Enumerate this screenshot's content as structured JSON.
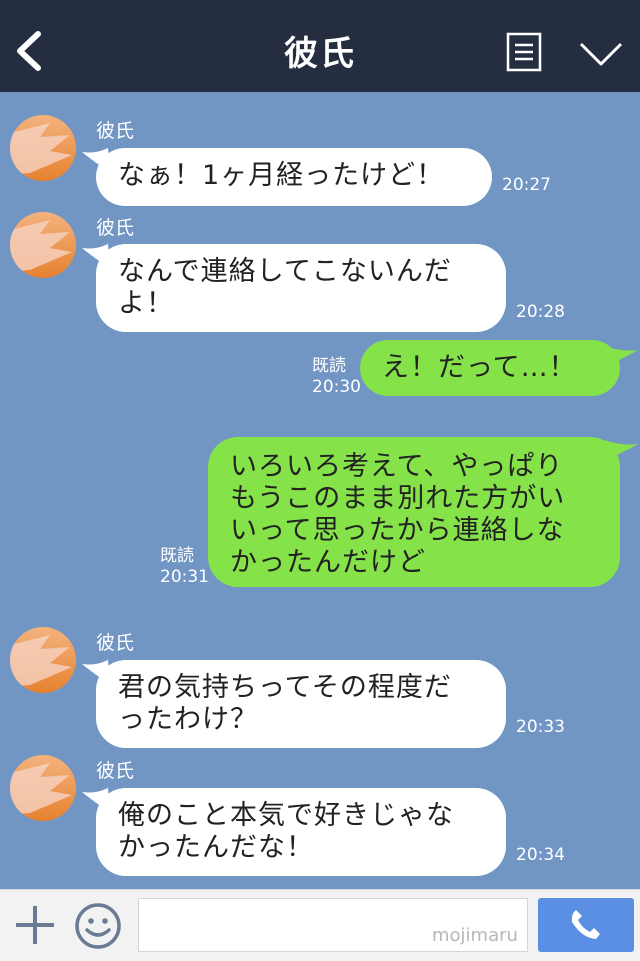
{
  "header": {
    "title": "彼氏",
    "back_icon": "chevron-left-icon",
    "note_icon": "note-icon",
    "menu_icon": "chevron-down-icon"
  },
  "colors": {
    "header_bg": "#252d41",
    "chat_bg": "#7196c4",
    "incoming_bubble": "#ffffff",
    "outgoing_bubble": "#85e249",
    "send_button": "#5b8fe3"
  },
  "messages": [
    {
      "direction": "in",
      "sender": "彼氏",
      "lines": [
        "なぁ！1ヶ月経ったけど！"
      ],
      "time": "20:27"
    },
    {
      "direction": "in",
      "sender": "彼氏",
      "lines": [
        "なんで連絡してこないんだ",
        "よ！"
      ],
      "time": "20:28"
    },
    {
      "direction": "out",
      "read": "既読",
      "lines": [
        "え！だって…！"
      ],
      "time": "20:30"
    },
    {
      "direction": "out",
      "read": "既読",
      "lines": [
        "いろいろ考えて、やっぱり",
        "もうこのまま別れた方がい",
        "いって思ったから連絡しな",
        "かったんだけど"
      ],
      "time": "20:31"
    },
    {
      "direction": "in",
      "sender": "彼氏",
      "lines": [
        "君の気持ちってその程度だ",
        "ったわけ？"
      ],
      "time": "20:33"
    },
    {
      "direction": "in",
      "sender": "彼氏",
      "lines": [
        "俺のこと本気で好きじゃな",
        "かったんだな！"
      ],
      "time": "20:34"
    }
  ],
  "footer": {
    "plus_icon": "plus-icon",
    "emoji_icon": "smile-icon",
    "input_value": "",
    "watermark": "mojimaru",
    "call_icon": "phone-icon"
  }
}
